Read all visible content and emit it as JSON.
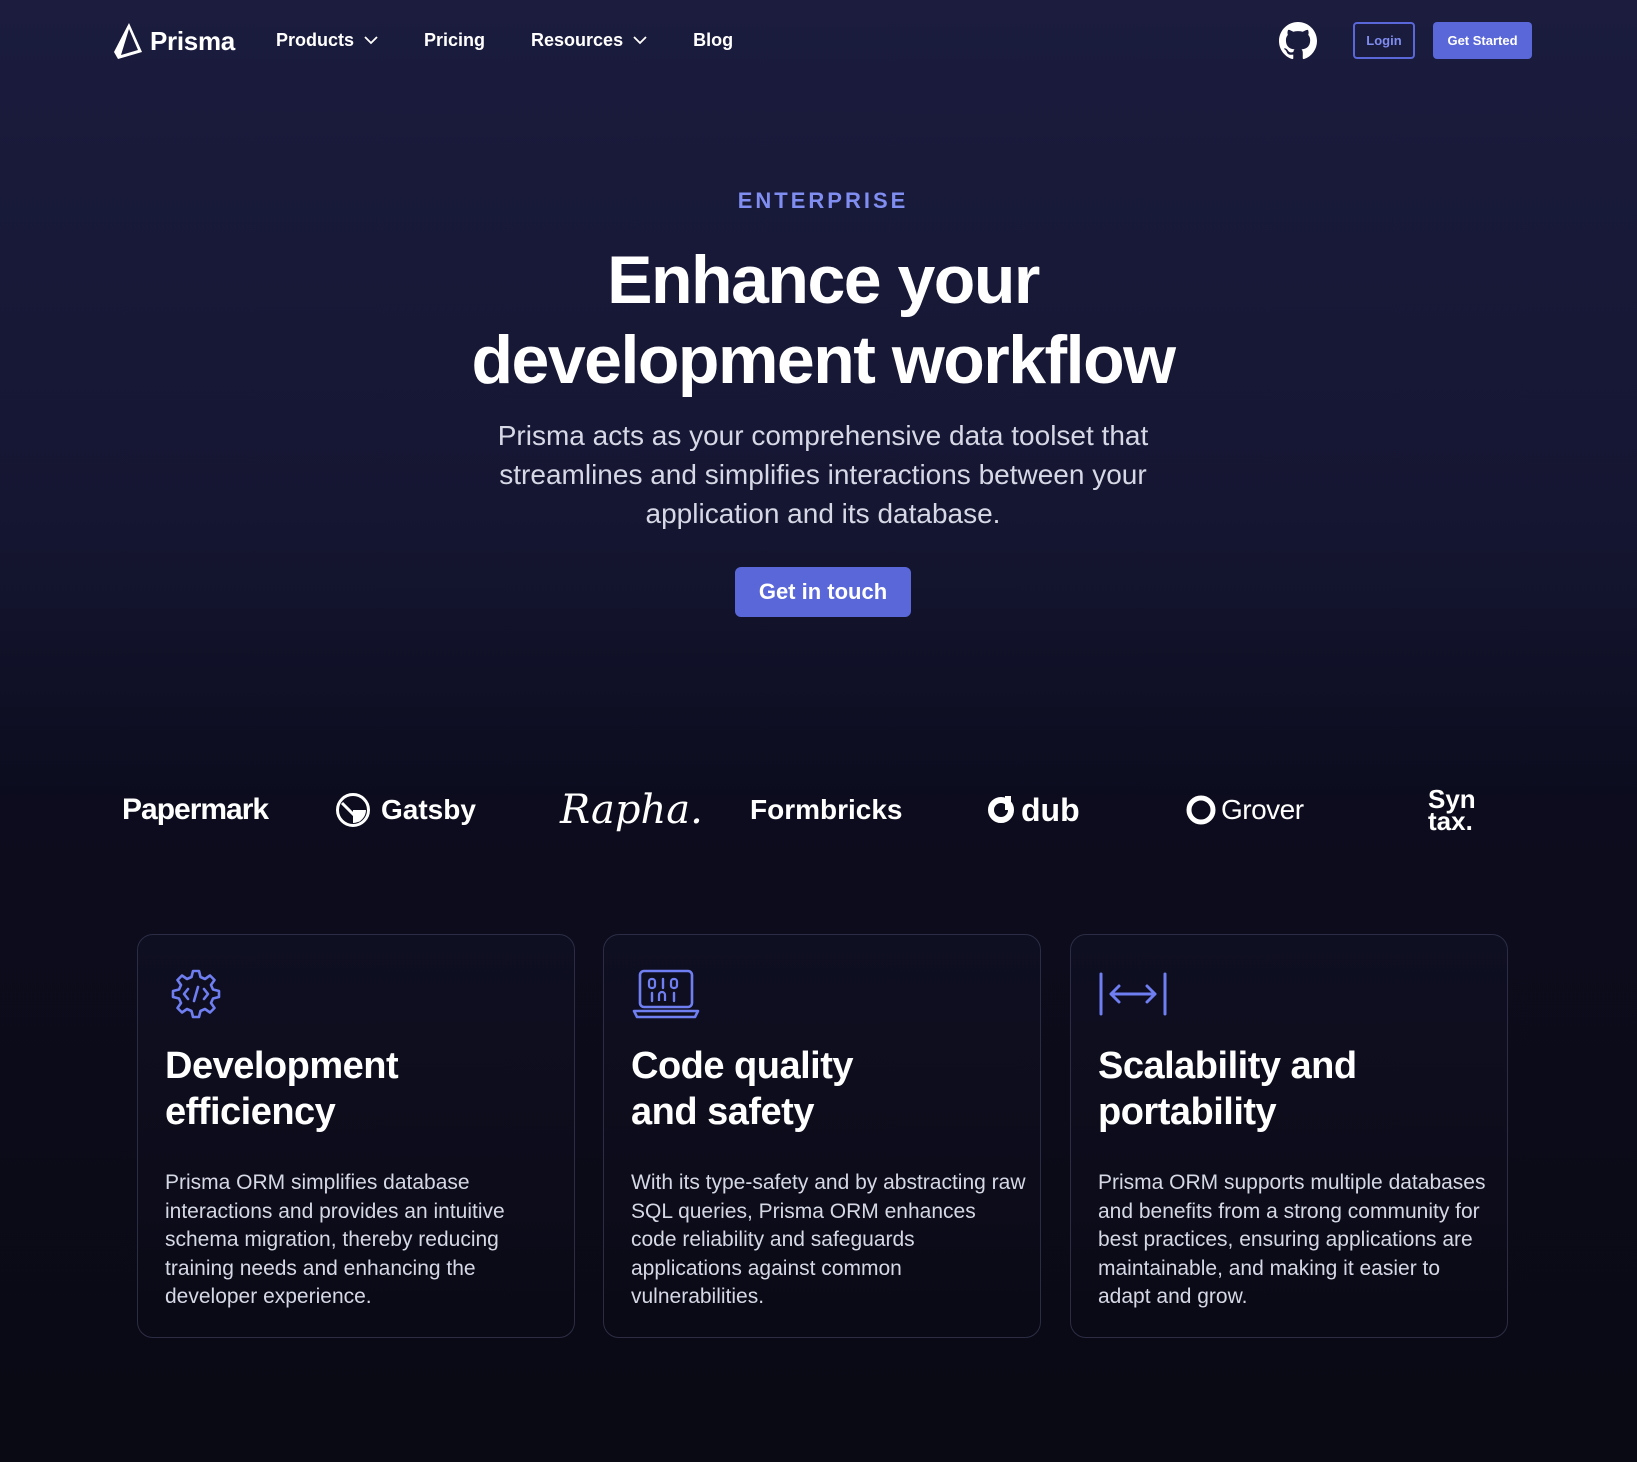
{
  "nav": {
    "logo_text": "Prisma",
    "links": [
      {
        "label": "Products",
        "has_dropdown": true
      },
      {
        "label": "Pricing",
        "has_dropdown": false
      },
      {
        "label": "Resources",
        "has_dropdown": true
      },
      {
        "label": "Blog",
        "has_dropdown": false
      }
    ],
    "github_icon": "github-icon",
    "login_label": "Login",
    "get_started_label": "Get Started"
  },
  "hero": {
    "eyebrow": "ENTERPRISE",
    "title_line1": "Enhance your",
    "title_line2": "development workflow",
    "subtitle": "Prisma acts as your comprehensive data toolset that streamlines and simplifies interactions between your application and its database.",
    "cta_label": "Get in touch"
  },
  "logos": {
    "papermark": "Papermark",
    "gatsby": "Gatsby",
    "rapha": "Rapha.",
    "formbricks": "Formbricks",
    "dub": "dub",
    "grover": "Grover",
    "syntax_line1": "Syn",
    "syntax_line2": "tax."
  },
  "cards": [
    {
      "icon": "gear-code-icon",
      "title_line1": "Development",
      "title_line2": "efficiency",
      "text": "Prisma ORM simplifies database interactions and provides an intuitive schema migration, thereby reducing training needs and enhancing the developer experience."
    },
    {
      "icon": "laptop-binary-icon",
      "title_line1": "Code quality",
      "title_line2": "and safety",
      "text": "With its type-safety and by abstracting raw SQL queries, Prisma ORM enhances code reliability and safeguards applications against common vulnerabilities."
    },
    {
      "icon": "horizontal-expand-icon",
      "title_line1": "Scalability and",
      "title_line2": "portability",
      "text": "Prisma ORM supports multiple databases and benefits from a strong community for best practices, ensuring applications are maintainable, and making it easier to adapt and grow."
    }
  ],
  "colors": {
    "accent": "#5a67d8",
    "eyebrow": "#7f8ef0",
    "background_top": "#1b1c3e",
    "background_bottom": "#0a0a14"
  }
}
